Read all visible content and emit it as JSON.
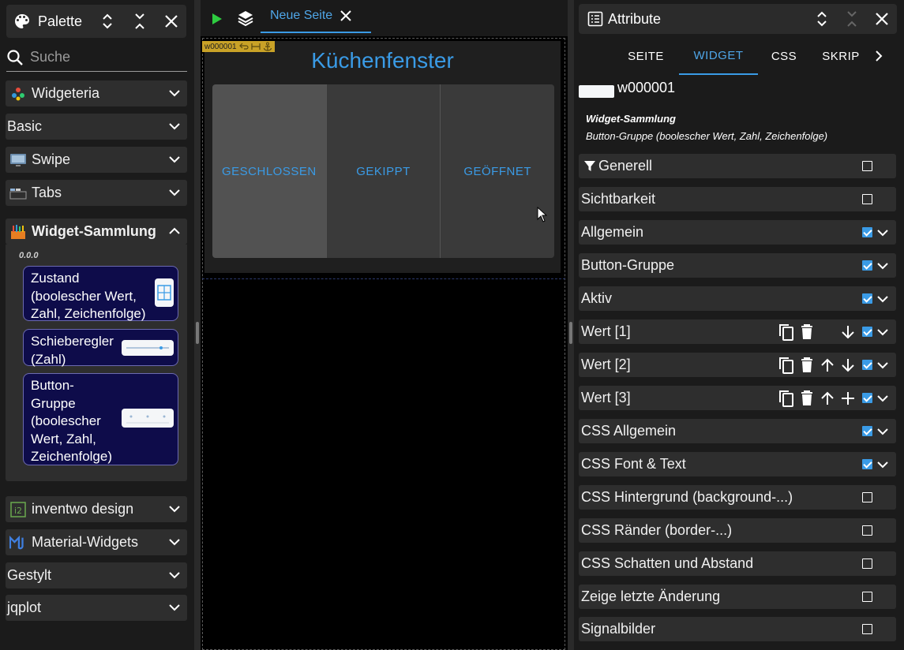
{
  "palette": {
    "title": "Palette",
    "search": {
      "placeholder": "Suche",
      "value": ""
    },
    "categories": [
      {
        "label": "Widgeteria",
        "icon": "widgeteria-logo-icon"
      },
      {
        "label": "Basic"
      },
      {
        "label": "Swipe",
        "icon": "swipe-logo-icon"
      },
      {
        "label": "Tabs",
        "icon": "tabs-logo-icon"
      },
      {
        "label": "Widget-Sammlung",
        "icon": "widget-sammlung-logo-icon",
        "expanded": true
      },
      {
        "label": "inventwo design",
        "icon": "inventwo-logo-icon"
      },
      {
        "label": "Material-Widgets",
        "icon": "material-widgets-logo-icon"
      },
      {
        "label": "Gestylt"
      },
      {
        "label": "jqplot"
      }
    ],
    "collection": {
      "version": "0.0.0",
      "widgets": [
        {
          "label": "Zustand (boolescher Wert, Zahl, Zeichenfolge)"
        },
        {
          "label": "Schieberegler (Zahl)"
        },
        {
          "label": "Button-Gruppe (boolescher Wert, Zahl, Zeichenfolge)"
        }
      ]
    }
  },
  "editor": {
    "tab_label": "Neue Seite",
    "widget_tag": "w000001",
    "widget": {
      "title": "Küchenfenster",
      "buttons": [
        "GESCHLOSSEN",
        "GEKIPPT",
        "GEÖFFNET"
      ],
      "active_index": 0
    }
  },
  "attributes": {
    "title": "Attribute",
    "tabs": [
      "SEITE",
      "WIDGET",
      "CSS",
      "SKRIP"
    ],
    "active_tab": "WIDGET",
    "widget_id": "w000001",
    "widget_set": "Widget-Sammlung",
    "widget_type": "Button-Gruppe (boolescher Wert, Zahl, Zeichenfolge)",
    "groups": [
      {
        "label": "Generell",
        "checked": false,
        "filter_icon": true
      },
      {
        "label": "Sichtbarkeit",
        "checked": false
      },
      {
        "label": "Allgemein",
        "checked": true,
        "expand": true
      },
      {
        "label": "Button-Gruppe",
        "checked": true,
        "expand": true
      },
      {
        "label": "Aktiv",
        "checked": true,
        "expand": true
      },
      {
        "label": "Wert [1]",
        "checked": true,
        "expand": true,
        "actions": [
          "copy",
          "delete",
          "",
          "down"
        ]
      },
      {
        "label": "Wert [2]",
        "checked": true,
        "expand": true,
        "actions": [
          "copy",
          "delete",
          "up",
          "down"
        ]
      },
      {
        "label": "Wert [3]",
        "checked": true,
        "expand": true,
        "actions": [
          "copy",
          "delete",
          "up",
          "add"
        ]
      },
      {
        "label": "CSS Allgemein",
        "checked": true,
        "expand": true
      },
      {
        "label": "CSS Font & Text",
        "checked": true,
        "expand": true
      },
      {
        "label": "CSS Hintergrund (background-...)",
        "checked": false
      },
      {
        "label": "CSS Ränder (border-...)",
        "checked": false
      },
      {
        "label": "CSS Schatten und Abstand",
        "checked": false
      },
      {
        "label": "Zeige letzte Änderung",
        "checked": false
      },
      {
        "label": "Signalbilder",
        "checked": false
      }
    ]
  },
  "colors": {
    "accent": "#3a9be6",
    "widget_card": "#0e0c4a",
    "tag": "#c9a227",
    "run": "#2ecc40"
  }
}
